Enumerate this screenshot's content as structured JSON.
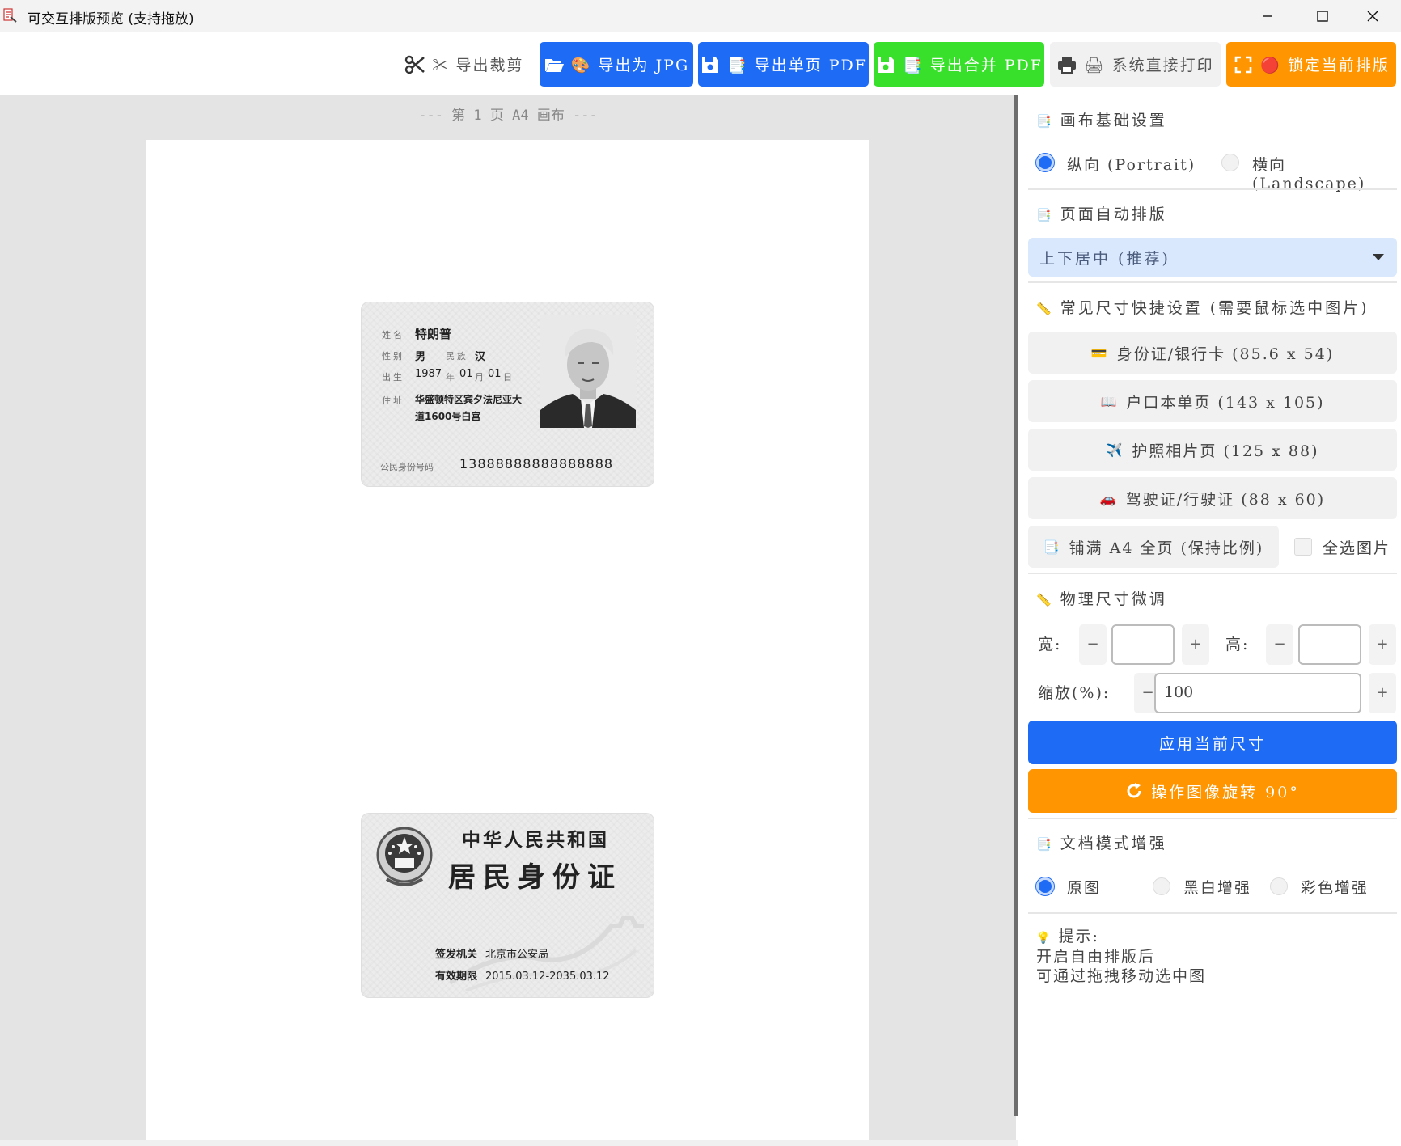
{
  "window": {
    "title": "可交互排版预览 (支持拖放)"
  },
  "toolbar": {
    "crop_label": "✂ 导出裁剪",
    "jpg_label": "🎨 导出为 JPG",
    "single_pdf_label": "📑 导出单页 PDF",
    "merge_pdf_label": "📑 导出合并 PDF",
    "print_label": "🖨 系统直接打印",
    "lock_label": "🔴 锁定当前排版",
    "colors": {
      "jpg_bg": "#1e6bf5",
      "pdf_bg": "#1e6bf5",
      "merge_bg": "#38e02c",
      "print_bg": "#f1f1f1",
      "lock_bg": "#ff9500"
    }
  },
  "preview": {
    "page_label": "--- 第 1 页 A4 画布 ---",
    "front_card": {
      "name_label": "姓名",
      "name_value": "特朗普",
      "gender_label": "性别",
      "gender_value": "男",
      "ethnic_label": "民族",
      "ethnic_value": "汉",
      "birth_label": "出生",
      "birth_year": "1987",
      "birth_year_unit": "年",
      "birth_month": "01",
      "birth_month_unit": "月",
      "birth_day": "01",
      "birth_day_unit": "日",
      "address_label": "住址",
      "address_line1": "华盛顿特区宾夕法尼亚大",
      "address_line2": "道1600号白宫",
      "id_label": "公民身份号码",
      "id_number": "13888888888888888"
    },
    "back_card": {
      "title1": "中华人民共和国",
      "title2": "居民身份证",
      "authority_label": "签发机关",
      "authority_value": "北京市公安局",
      "validity_label": "有效期限",
      "validity_value": "2015.03.12-2035.03.12"
    }
  },
  "panel": {
    "canvas_title": "画布基础设置",
    "orientation": {
      "portrait": "纵向 (Portrait)",
      "landscape": "横向 (Landscape)",
      "selected": "portrait"
    },
    "auto_layout_title": "页面自动排版",
    "auto_layout_value": "上下居中 (推荐)",
    "quick_size_title": "常见尺寸快捷设置 (需要鼠标选中图片)",
    "quick_sizes": [
      {
        "icon": "💳",
        "label": "身份证/银行卡 (85.6 x 54)"
      },
      {
        "icon": "📖",
        "label": "户口本单页 (143 x 105)"
      },
      {
        "icon": "✈️",
        "label": "护照相片页 (125 x 88)"
      },
      {
        "icon": "🚗",
        "label": "驾驶证/行驶证 (88 x 60)"
      }
    ],
    "fill_a4_label": "铺满 A4 全页 (保持比例)",
    "select_all_label": "全选图片",
    "fine_tune_title": "物理尺寸微调",
    "width_label": "宽:",
    "height_label": "高:",
    "width_value": "",
    "height_value": "",
    "scale_label": "缩放(%):",
    "scale_value": "100",
    "minus": "−",
    "plus": "+",
    "apply_label": "应用当前尺寸",
    "rotate_label": "操作图像旋转 90°",
    "doc_mode_title": "文档模式增强",
    "doc_modes": [
      "原图",
      "黑白增强",
      "彩色增强"
    ],
    "doc_mode_selected": "原图",
    "hint_title": "提示:",
    "hint_line1": "开启自由排版后",
    "hint_line2": "可通过拖拽移动选中图",
    "colors": {
      "accent_blue": "#1e6bf5",
      "accent_orange": "#ff9500"
    }
  }
}
